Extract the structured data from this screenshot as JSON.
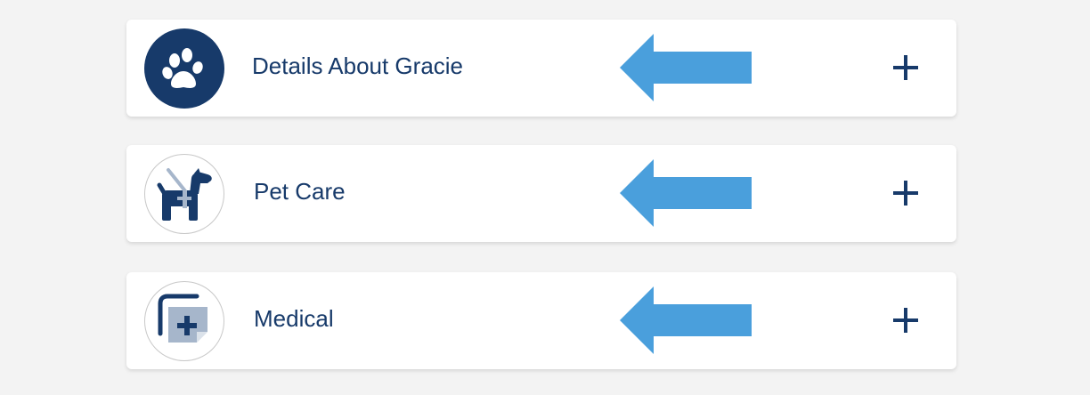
{
  "sections": [
    {
      "label": "Details About Gracie",
      "icon": "paw-icon"
    },
    {
      "label": "Pet Care",
      "icon": "dog-icon"
    },
    {
      "label": "Medical",
      "icon": "medical-record-icon"
    }
  ],
  "colors": {
    "navy": "#173a6a",
    "arrow": "#4a9fdc",
    "background": "#f3f3f3",
    "card": "#ffffff",
    "light_blue_gray": "#a6b6cb"
  }
}
